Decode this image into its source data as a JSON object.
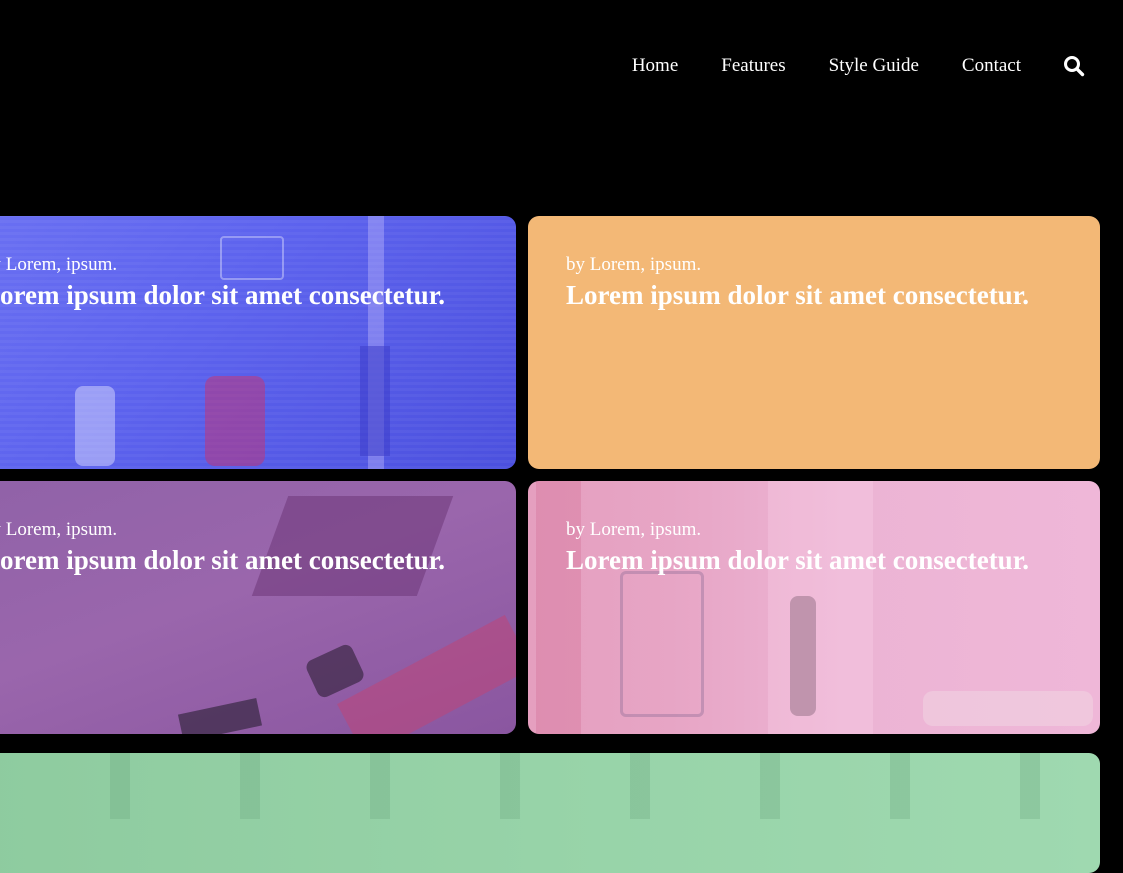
{
  "nav": {
    "links": [
      {
        "label": "Home"
      },
      {
        "label": "Features"
      },
      {
        "label": "Style Guide"
      },
      {
        "label": "Contact"
      }
    ],
    "search_icon": "search-icon"
  },
  "cards": [
    {
      "byline": "by Lorem, ipsum.",
      "title": "Lorem ipsum dolor sit amet consectetur.",
      "color": "#5d63ee"
    },
    {
      "byline": "by Lorem, ipsum.",
      "title": "Lorem ipsum dolor sit amet consectetur.",
      "color": "#f3b876"
    },
    {
      "byline": "by Lorem, ipsum.",
      "title": "Lorem ipsum dolor sit amet consectetur.",
      "color": "#9062a8"
    },
    {
      "byline": "by Lorem, ipsum.",
      "title": "Lorem ipsum dolor sit amet consectetur.",
      "color": "#e7a5c5"
    },
    {
      "color": "#97d3a8"
    }
  ]
}
